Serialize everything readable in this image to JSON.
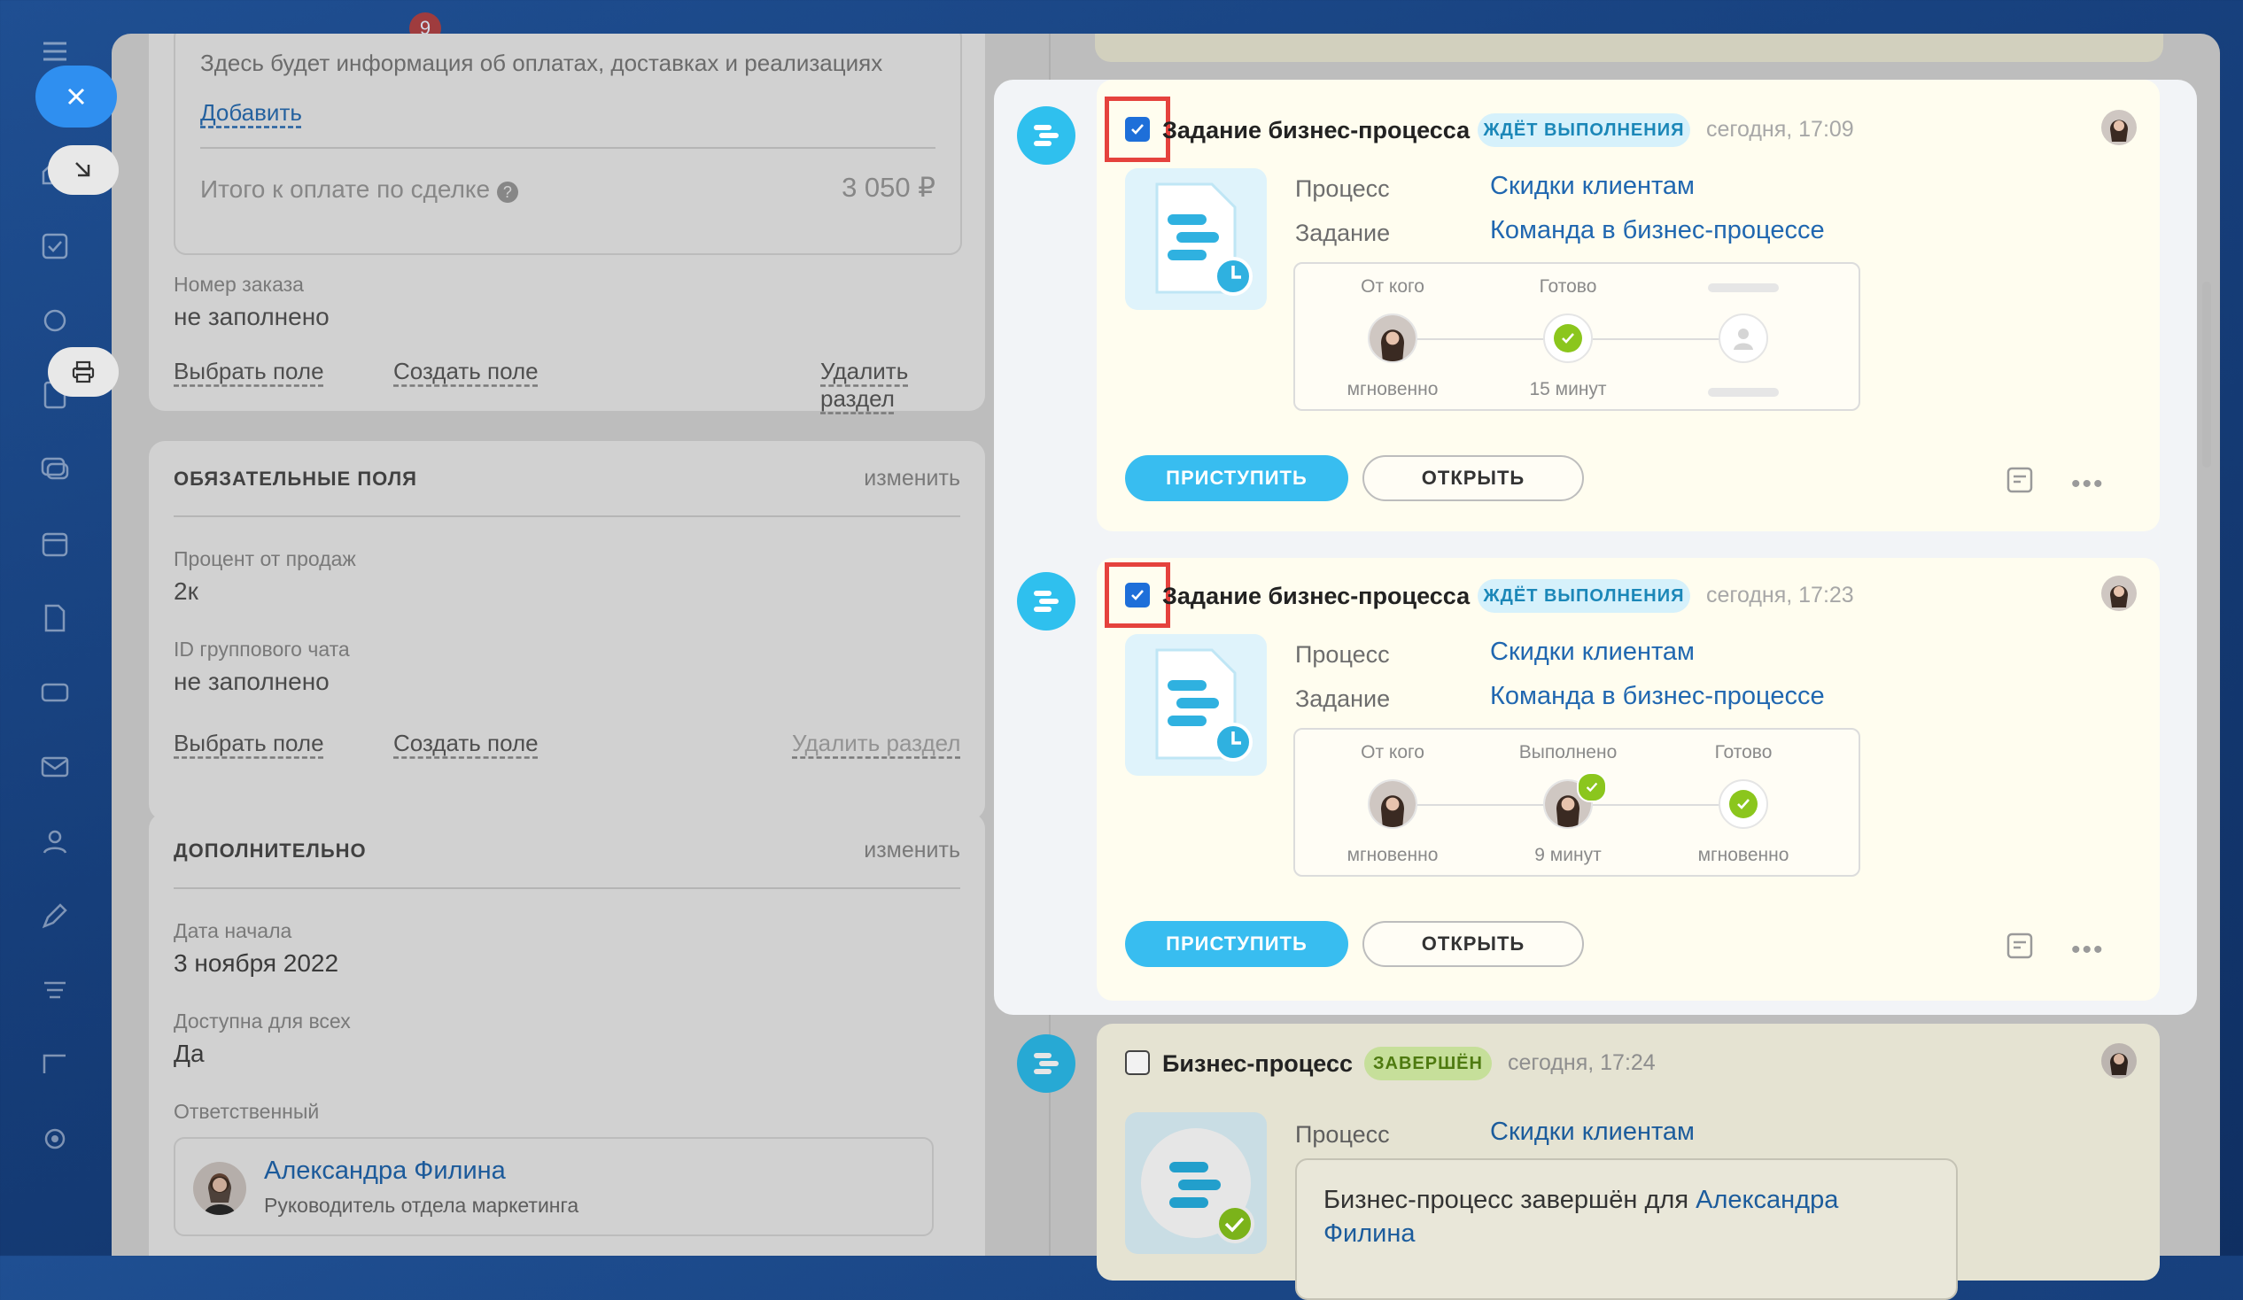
{
  "nav": {
    "notify_badge": "9"
  },
  "left": {
    "payments": {
      "info": "Здесь будет информация об оплатах, доставках и реализациях",
      "add_link": "Добавить",
      "total_label": "Итого к оплате по сделке",
      "total_value": "3 050 ₽",
      "order_label": "Номер заказа",
      "order_value": "не заполнено",
      "choose_field": "Выбрать поле",
      "create_field": "Создать поле",
      "delete_section": "Удалить раздел"
    },
    "required": {
      "title": "ОБЯЗАТЕЛЬНЫЕ ПОЛЯ",
      "change": "изменить",
      "f1_label": "Процент от продаж",
      "f1_value": "2к",
      "f2_label": "ID группового чата",
      "f2_value": "не заполнено",
      "choose_field": "Выбрать поле",
      "create_field": "Создать поле",
      "delete_section": "Удалить раздел"
    },
    "additional": {
      "title": "ДОПОЛНИТЕЛЬНО",
      "change": "изменить",
      "f1_label": "Дата начала",
      "f1_value": "3 ноября 2022",
      "f2_label": "Доступна для всех",
      "f2_value": "Да",
      "f3_label": "Ответственный",
      "person_name": "Александра Филина",
      "person_role": "Руководитель отдела маркетинга"
    }
  },
  "timeline": {
    "items": [
      {
        "title": "Задание бизнес-процесса",
        "status": "ЖДЁТ ВЫПОЛНЕНИЯ",
        "time": "сегодня, 17:09",
        "process_label": "Процесс",
        "process_value": "Скидки клиентам",
        "task_label": "Задание",
        "task_value": "Команда в бизнес-процессе",
        "steps": [
          {
            "top": "От кого",
            "bottom": "мгновенно"
          },
          {
            "top": "Готово",
            "bottom": "15 минут"
          },
          {
            "top": "",
            "bottom": ""
          }
        ],
        "start": "ПРИСТУПИТЬ",
        "open": "ОТКРЫТЬ"
      },
      {
        "title": "Задание бизнес-процесса",
        "status": "ЖДЁТ ВЫПОЛНЕНИЯ",
        "time": "сегодня, 17:23",
        "process_label": "Процесс",
        "process_value": "Скидки клиентам",
        "task_label": "Задание",
        "task_value": "Команда в бизнес-процессе",
        "steps": [
          {
            "top": "От кого",
            "bottom": "мгновенно"
          },
          {
            "top": "Выполнено",
            "bottom": "9 минут"
          },
          {
            "top": "Готово",
            "bottom": "мгновенно"
          }
        ],
        "start": "ПРИСТУПИТЬ",
        "open": "ОТКРЫТЬ"
      },
      {
        "title": "Бизнес-процесс",
        "status": "ЗАВЕРШЁН",
        "time": "сегодня, 17:24",
        "process_label": "Процесс",
        "process_value": "Скидки клиентам",
        "done_text": "Бизнес-процесс завершён для",
        "done_person_first": "Александра",
        "done_person_last": "Филина"
      }
    ]
  },
  "colors": {
    "accent": "#38bdf0",
    "link": "#2067b0",
    "highlight": "#e5423d",
    "success": "#8bc61d"
  }
}
